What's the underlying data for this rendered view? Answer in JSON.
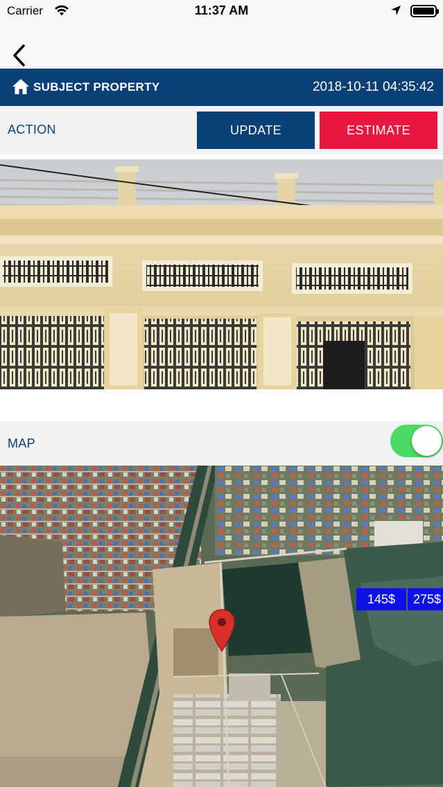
{
  "status_bar": {
    "carrier": "Carrier",
    "time": "11:37 AM",
    "battery_level": 1.0,
    "icons": [
      "wifi-icon",
      "location-arrow-icon",
      "battery-icon"
    ]
  },
  "nav": {
    "back_icon": "chevron-left-icon"
  },
  "header": {
    "icon": "home-icon",
    "title": "SUBJECT PROPERTY",
    "datetime": "2018-10-11 04:35:42"
  },
  "action": {
    "label": "ACTION",
    "update_label": "UPDATE",
    "estimate_label": "ESTIMATE"
  },
  "photo": {
    "description_icon": "property-photo"
  },
  "map_section": {
    "label": "MAP",
    "toggle_on": true,
    "price_tags": [
      "145$",
      "275$"
    ],
    "pin_icon": "map-pin-icon"
  },
  "colors": {
    "brand_blue": "#0a3f78",
    "estimate_red": "#e8173f",
    "toggle_green": "#4cd964",
    "price_tag_blue": "#1010e8",
    "pin_red": "#d9302c"
  }
}
